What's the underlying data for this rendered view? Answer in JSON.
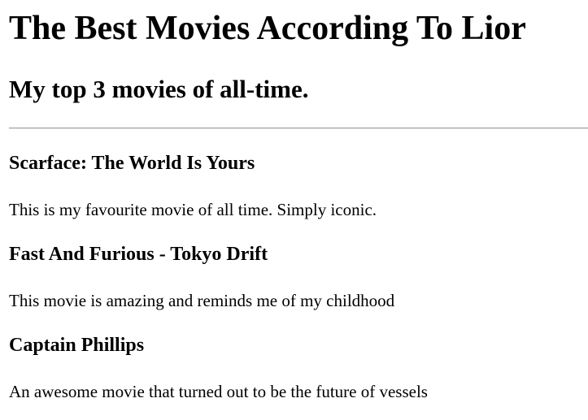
{
  "page": {
    "title": "The Best Movies According To Lior",
    "subtitle": "My top 3 movies of all-time."
  },
  "movies": [
    {
      "title": "Scarface: The World Is Yours",
      "description": "This is my favourite movie of all time. Simply iconic."
    },
    {
      "title": "Fast And Furious - Tokyo Drift",
      "description": "This movie is amazing and reminds me of my childhood"
    },
    {
      "title": "Captain Phillips",
      "description": "An awesome movie that turned out to be the future of vessels"
    }
  ]
}
